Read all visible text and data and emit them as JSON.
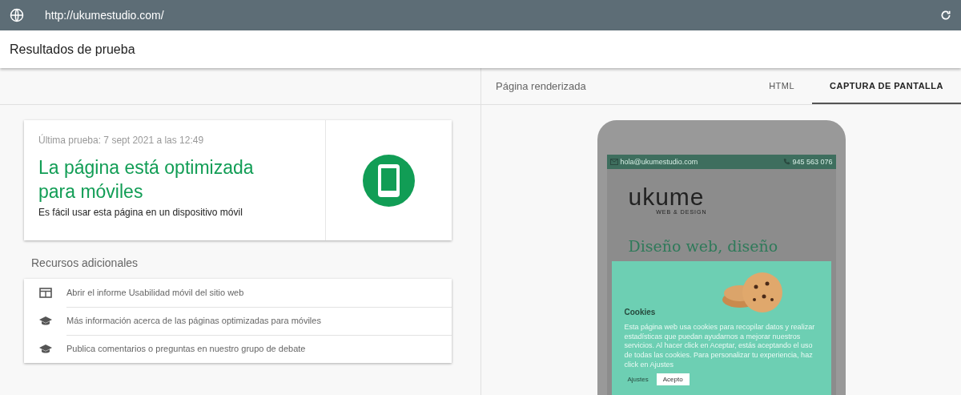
{
  "address_bar": {
    "url": "http://ukumestudio.com/"
  },
  "header": {
    "title": "Resultados de prueba"
  },
  "result": {
    "last_test": "Última prueba: 7 sept 2021 a las 12:49",
    "headline": "La página está optimizada para móviles",
    "description": "Es fácil usar esta página en un dispositivo móvil"
  },
  "resources": {
    "title": "Recursos adicionales",
    "items": [
      {
        "kind": "report",
        "label": "Abrir el informe Usabilidad móvil del sitio web"
      },
      {
        "kind": "learn",
        "label": "Más información acerca de las páginas optimizadas para móviles"
      },
      {
        "kind": "learn",
        "label": "Publica comentarios o preguntas en nuestro grupo de debate"
      }
    ]
  },
  "preview": {
    "title": "Página renderizada",
    "tabs": [
      {
        "label": "HTML",
        "selected": false
      },
      {
        "label": "CAPTURA DE PANTALLA",
        "selected": true
      }
    ],
    "phone": {
      "email": "hola@ukumestudio.com",
      "phone": "945 563 076",
      "logo": "ukume",
      "logo_tagline": "WEB & DESIGN",
      "heading": "Diseño web, diseño",
      "cookie_dialog": {
        "title": "Cookies",
        "text": "Esta página web usa cookies para recopilar datos y realizar estadísticas que puedan ayudarnos a mejorar nuestros servicios. Al hacer click en Aceptar, estás aceptando el uso de todas las cookies. Para personalizar tu experiencia, haz click en Ajustes",
        "buttons": [
          {
            "kind": "link",
            "label": "Ajustes"
          },
          {
            "kind": "primary",
            "label": "Acepto"
          }
        ]
      }
    }
  }
}
